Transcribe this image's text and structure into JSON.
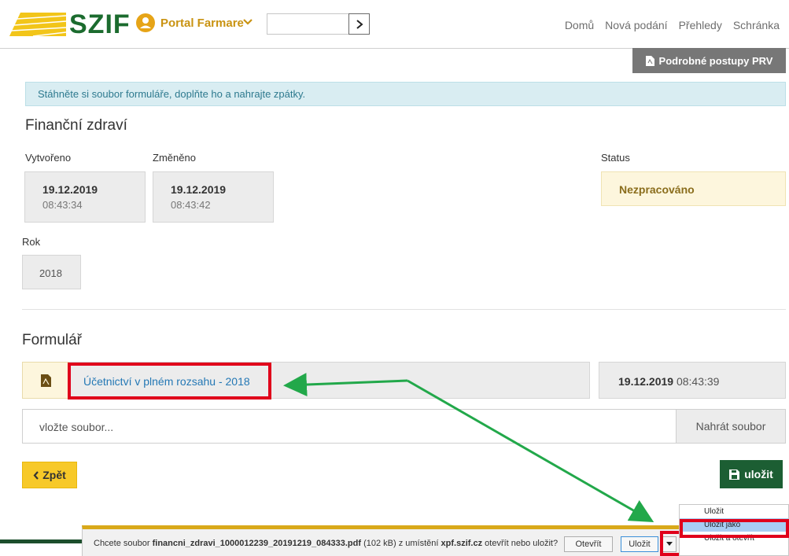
{
  "header": {
    "logo_text": "SZIF",
    "portal_title": "Portal Farmare",
    "search_placeholder": "",
    "nav": [
      "Domů",
      "Nová podání",
      "Přehledy",
      "Schránka"
    ]
  },
  "prv_button": "Podrobné postupy PRV",
  "alert": "Stáhněte si soubor formuláře, doplňte ho a nahrajte zpátky.",
  "page_title": "Finanční zdraví",
  "created": {
    "label": "Vytvořeno",
    "date": "19.12.2019",
    "time": "08:43:34"
  },
  "changed": {
    "label": "Změněno",
    "date": "19.12.2019",
    "time": "08:43:42"
  },
  "status": {
    "label": "Status",
    "value": "Nezpracováno"
  },
  "year": {
    "label": "Rok",
    "value": "2018"
  },
  "form": {
    "title": "Formulář",
    "file_link": "Účetnictví v plném rozsahu - 2018",
    "file_date": "19.12.2019",
    "file_time": "08:43:39",
    "upload_placeholder": "vložte soubor...",
    "upload_button": "Nahrát soubor"
  },
  "buttons": {
    "back": "Zpět",
    "save": "uložit"
  },
  "download_bar": {
    "prefix": "Chcete soubor ",
    "filename": "financni_zdravi_1000012239_20191219_084333.pdf",
    "size": " (102 kB) z umístění ",
    "host": "xpf.szif.cz",
    "suffix": " otevřít nebo uložit?",
    "open": "Otevřít",
    "save": "Uložit"
  },
  "save_menu": [
    "Uložit",
    "Uložit jako",
    "Uložit a otevřít"
  ],
  "colors": {
    "brand_green": "#1b6b2e",
    "accent_yellow": "#f7c928",
    "highlight_red": "#e0001b",
    "annotation_green": "#22a84a"
  }
}
